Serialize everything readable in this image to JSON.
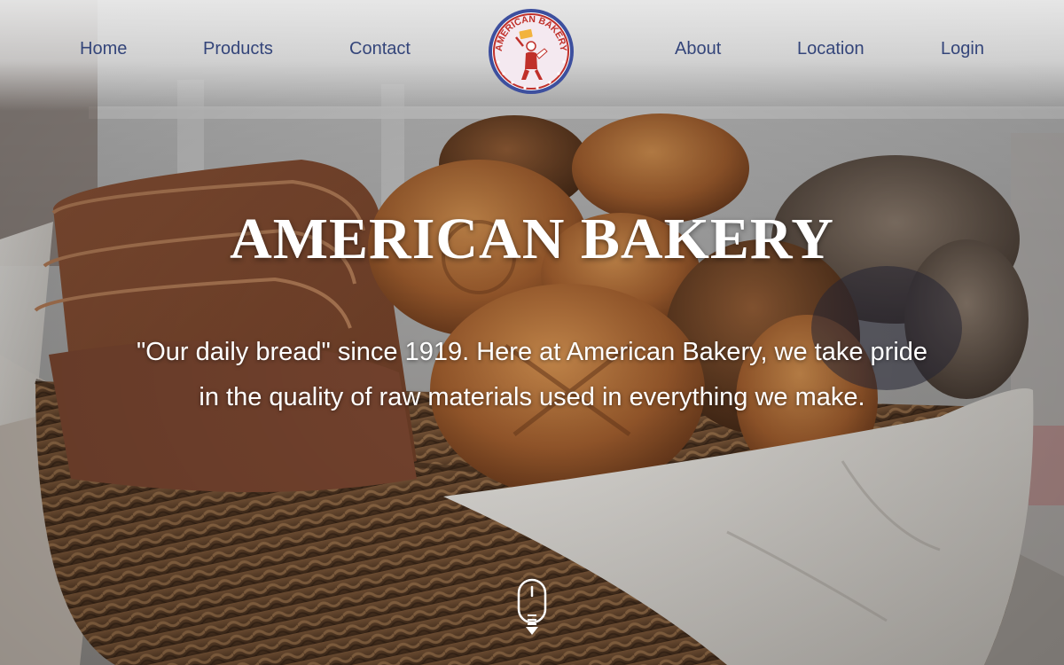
{
  "nav": {
    "left": [
      {
        "label": "Home"
      },
      {
        "label": "Products"
      },
      {
        "label": "Contact"
      }
    ],
    "right": [
      {
        "label": "About"
      },
      {
        "label": "Location"
      },
      {
        "label": "Login"
      }
    ],
    "logo": {
      "text": "AMERICAN BAKERY",
      "icon": "baker-chef-icon"
    }
  },
  "hero": {
    "title": "AMERICAN BAKERY",
    "tagline": "\"Our daily bread\" since 1919. Here at American Bakery, we take pride in the quality of raw materials used in everything we make.",
    "background": "bread-basket-photo",
    "scroll_icon": "mouse-scroll-down-icon"
  },
  "colors": {
    "nav_text": "#34457a",
    "logo_ring": "#3d4f9e",
    "logo_red": "#c0302a",
    "logo_gold": "#f2b33d",
    "hero_text": "#ffffff"
  }
}
